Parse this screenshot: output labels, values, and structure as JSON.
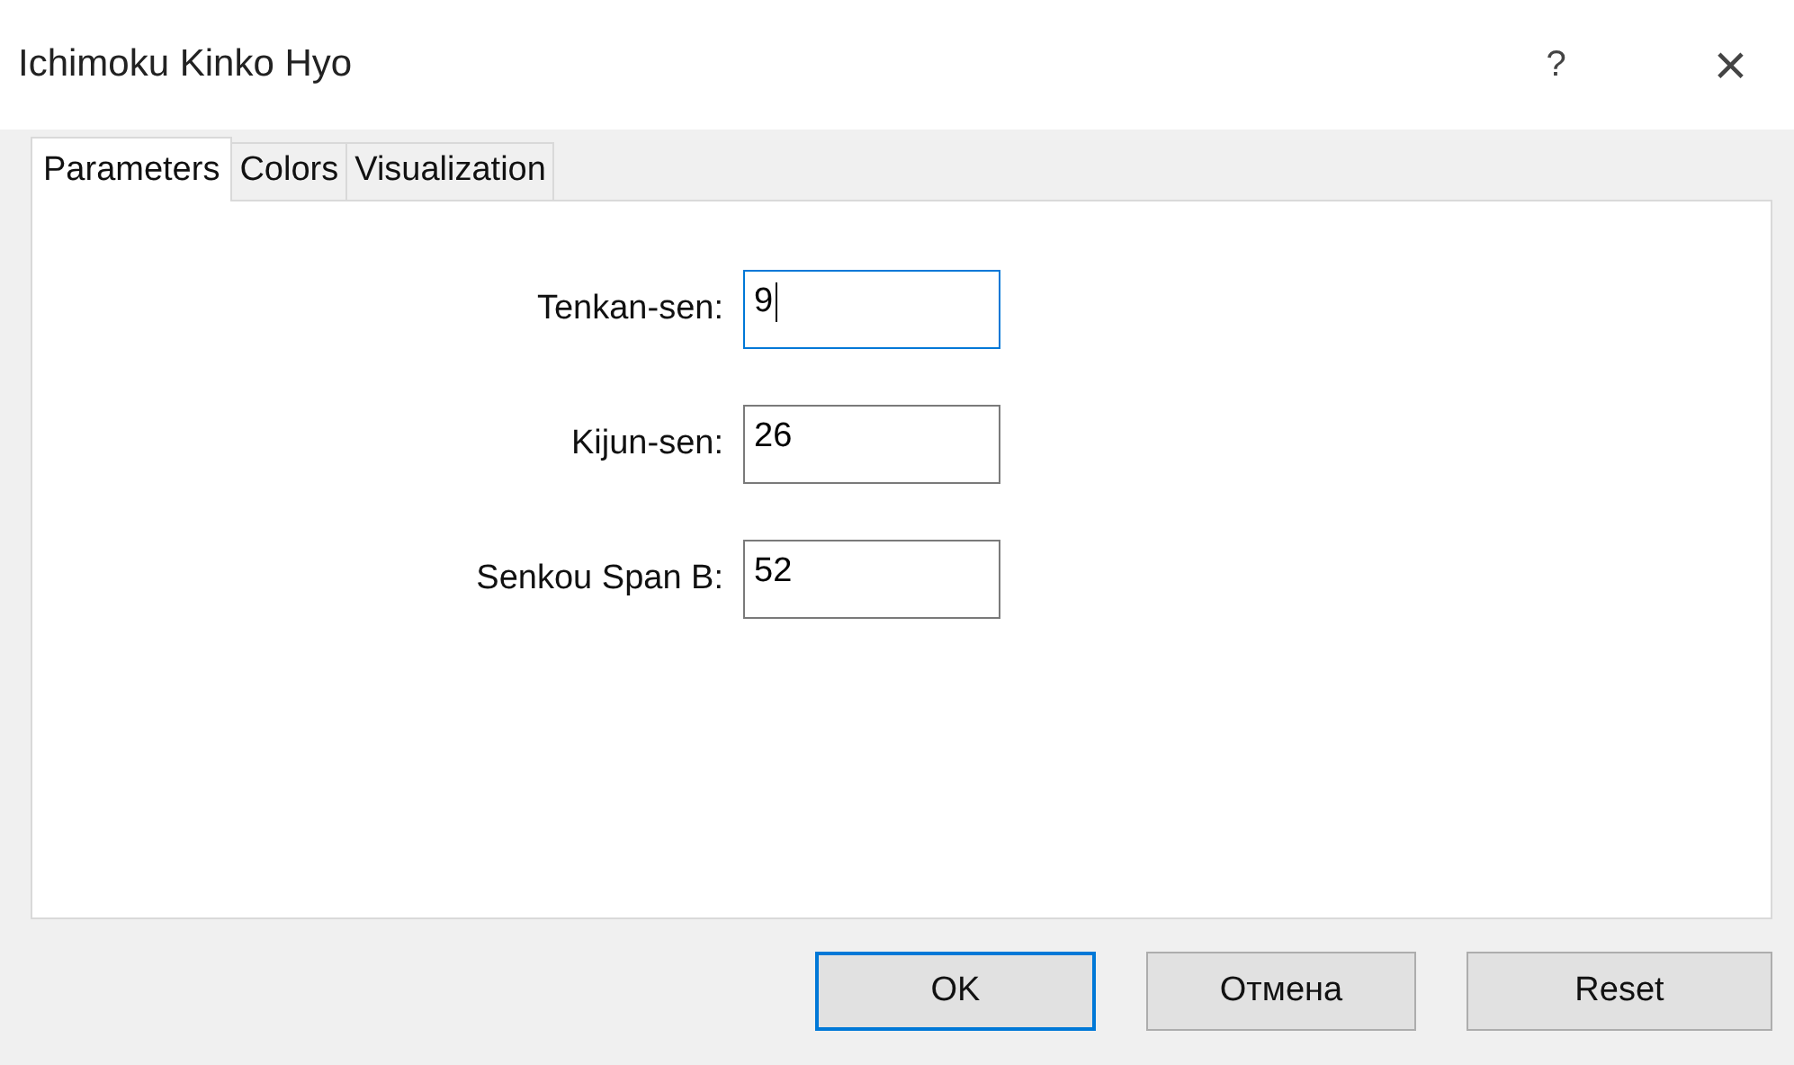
{
  "window": {
    "title": "Ichimoku Kinko Hyo",
    "help": "?",
    "close": "×"
  },
  "tabs": [
    {
      "label": "Parameters",
      "selected": true
    },
    {
      "label": "Colors",
      "selected": false
    },
    {
      "label": "Visualization",
      "selected": false
    }
  ],
  "fields": [
    {
      "label": "Tenkan-sen:",
      "value": "9",
      "focused": true
    },
    {
      "label": "Kijun-sen:",
      "value": "26",
      "focused": false
    },
    {
      "label": "Senkou Span B:",
      "value": "52",
      "focused": false
    }
  ],
  "buttons": [
    {
      "label": "OK",
      "default": true
    },
    {
      "label": "Отмена",
      "default": false
    },
    {
      "label": "Reset",
      "default": false
    }
  ]
}
